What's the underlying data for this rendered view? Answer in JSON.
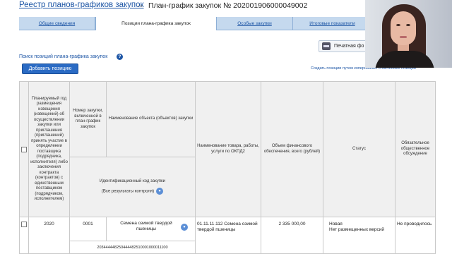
{
  "breadcrumb": {
    "registry_link": "Реестр планов-графиков закупок",
    "arrow": "→",
    "current": "План-график закупок № 202001906000049002"
  },
  "tabs": [
    {
      "label": "Общие сведения",
      "active": false
    },
    {
      "label": "Позиции плана-графика закупок",
      "active": true
    },
    {
      "label": "Особые закупки",
      "active": false
    },
    {
      "label": "Итоговые показатели",
      "active": false
    }
  ],
  "toolbar": {
    "print_label": "Печатная фо",
    "search_link": "Поиск позиций плана-графика закупок",
    "help_symbol": "?",
    "add_button": "Добавить позицию",
    "copy_link": "Создать позиции путем копирования отмеченных позиций"
  },
  "table": {
    "headers": {
      "planned_year": "Планируемый год размещения извещения (извещений) об осуществлении закупки или приглашения (приглашений) принять участие в определении поставщика (подрядчика, исполнителя) либо заключения контракта (контрактов) с единственным поставщиком (подрядчиком, исполнителем)",
      "purchase_number": "Номер закупки, включенной в план-график закупок",
      "object_name": "Наименование объекта (объектов) закупки",
      "product_name": "Наименование товара, работы, услуги по ОКПД2",
      "finance_volume": "Объем финансового обеспечения, всего (рублей)",
      "status": "Статус",
      "public_discussion": "Обязательное общественное обсуждение",
      "ikz": "Идентификационный код закупки",
      "ikz_filter": "(Все результаты контроля)"
    },
    "rows": [
      {
        "year": "2020",
        "number": "0001",
        "object": "Семена озимой твердой пшеницы",
        "product": "01.11.11.112 Семена озимой твердой пшеницы",
        "amount": "2 335 000,00",
        "status_line1": "Новая",
        "status_line2": "Нет размещенных версий",
        "discussion": "Не проводилось",
        "ikz": "203444448250444482510001000011100"
      }
    ]
  },
  "colors": {
    "link": "#1f57a6",
    "tab_bg": "#c5d9ee",
    "button": "#2b6bc4"
  }
}
